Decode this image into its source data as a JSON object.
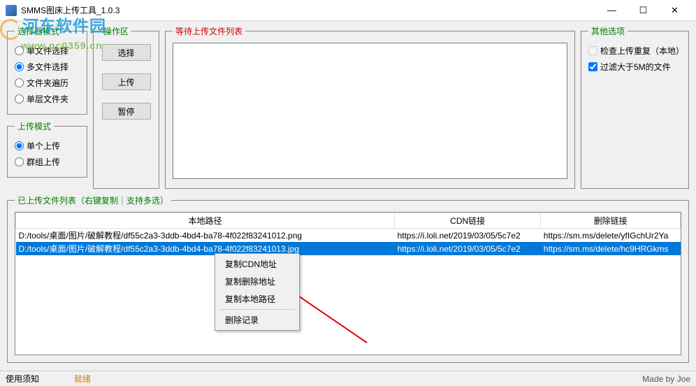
{
  "window": {
    "title": "SMMS图床上传工具_1.0.3",
    "minimize": "—",
    "maximize": "☐",
    "close": "✕"
  },
  "watermark": {
    "cn": "河东软件园",
    "url": "www.pc0359.cn"
  },
  "selectMode": {
    "legend": "选择器模式",
    "options": {
      "single": "单文件选择",
      "multi": "多文件选择",
      "folderRecursive": "文件夹遍历",
      "folderFlat": "单层文件夹"
    }
  },
  "uploadMode": {
    "legend": "上传模式",
    "options": {
      "single": "单个上传",
      "group": "群组上传"
    }
  },
  "operation": {
    "legend": "操作区",
    "select": "选择",
    "upload": "上传",
    "pause": "暂停"
  },
  "waitingList": {
    "legend": "等待上传文件列表"
  },
  "otherOptions": {
    "legend": "其他选项",
    "checkDup": "检查上传重复（本地）",
    "filter5M": "过滤大于5M的文件"
  },
  "uploadedList": {
    "legend": "已上传文件列表（右键复制｜支持多选）",
    "columns": {
      "localPath": "本地路径",
      "cdnLink": "CDN链接",
      "deleteLink": "删除链接"
    },
    "rows": [
      {
        "localPath": "D:/tools/桌面/图片/破解教程/df55c2a3-3ddb-4bd4-ba78-4f022f83241012.png",
        "cdnLink": "https://i.loli.net/2019/03/05/5c7e2",
        "deleteLink": "https://sm.ms/delete/yfIGchUr2Ya"
      },
      {
        "localPath": "D:/tools/桌面/图片/破解教程/df55c2a3-3ddb-4bd4-ba78-4f022f83241013.jpg",
        "cdnLink": "https://i.loli.net/2019/03/05/5c7e2",
        "deleteLink": "https://sm.ms/delete/hc9HRGkms"
      }
    ]
  },
  "contextMenu": {
    "copyCDN": "复制CDN地址",
    "copyDelete": "复制删除地址",
    "copyLocal": "复制本地路径",
    "deleteRecord": "删除记录"
  },
  "statusbar": {
    "usage": "使用须知",
    "ready": "就绪",
    "credit": "Made by Joe"
  }
}
